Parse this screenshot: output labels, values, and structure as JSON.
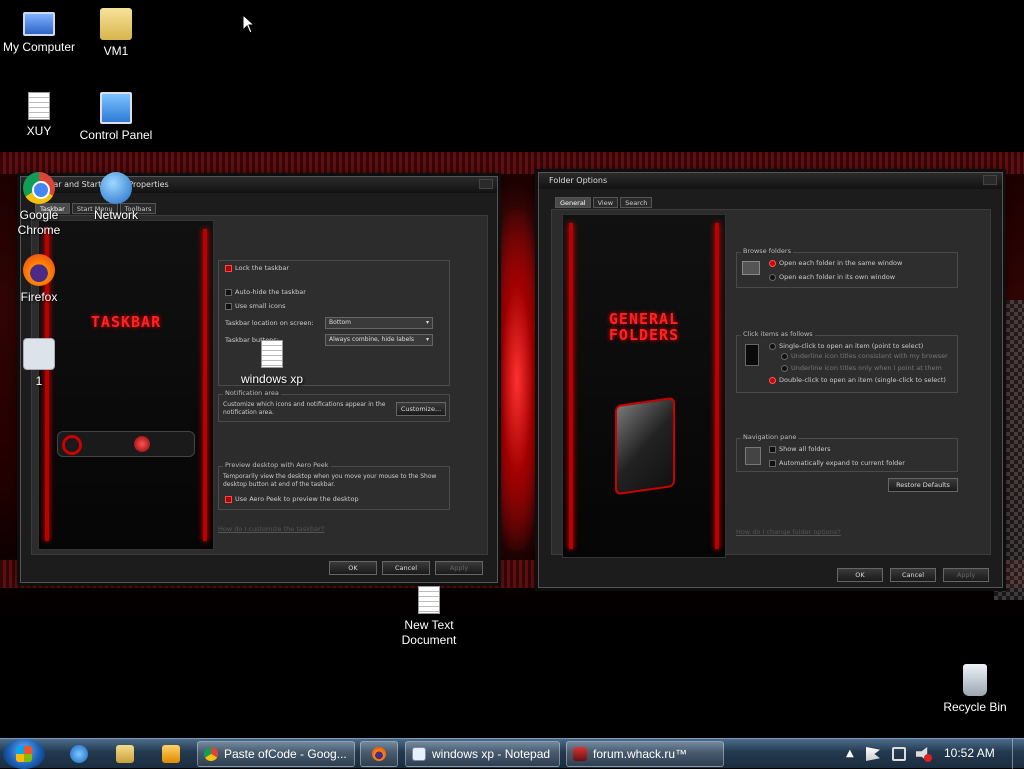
{
  "desktop": {
    "icons": [
      {
        "label": "My Computer",
        "icon": "computer-icon"
      },
      {
        "label": "VM1",
        "icon": "folder-user-icon"
      },
      {
        "label": "XUY",
        "icon": "text-document-icon"
      },
      {
        "label": "Control Panel",
        "icon": "control-panel-icon"
      },
      {
        "label": "Google\nChrome",
        "icon": "chrome-icon"
      },
      {
        "label": "Network",
        "icon": "network-icon"
      },
      {
        "label": "Firefox",
        "icon": "firefox-icon"
      },
      {
        "label": "1",
        "icon": "settings-file-icon"
      },
      {
        "label": "windows xp",
        "icon": "text-document-icon"
      },
      {
        "label": "New Text\nDocument",
        "icon": "text-document-icon"
      },
      {
        "label": "Recycle Bin",
        "icon": "recycle-bin-icon"
      }
    ]
  },
  "taskbar_props": {
    "title": "Taskbar and Start Menu Properties",
    "tabs": [
      "Taskbar",
      "Start Menu",
      "Toolbars"
    ],
    "preview_art": "TASKBAR",
    "appearance": {
      "lock": "Lock the taskbar",
      "autohide": "Auto-hide the taskbar",
      "small_icons": "Use small icons",
      "location_label": "Taskbar location on screen:",
      "location_value": "Bottom",
      "buttons_label": "Taskbar buttons:",
      "buttons_value": "Always combine, hide labels"
    },
    "notification": {
      "title": "Notification area",
      "desc": "Customize which icons and notifications appear in the notification area.",
      "customize": "Customize..."
    },
    "peek": {
      "title": "Preview desktop with Aero Peek",
      "desc": "Temporarily view the desktop when you move your mouse to the Show desktop button at end of the taskbar.",
      "option": "Use Aero Peek to preview the desktop"
    },
    "help_link": "How do I customize the taskbar?",
    "ok": "OK",
    "cancel": "Cancel",
    "apply": "Apply"
  },
  "folder_options": {
    "title": "Folder Options",
    "tabs": [
      "General",
      "View",
      "Search"
    ],
    "preview_art_1": "GENERAL",
    "preview_art_2": "FOLDERS",
    "browse": {
      "title": "Browse folders",
      "same": "Open each folder in the same window",
      "own": "Open each folder in its own window"
    },
    "click": {
      "title": "Click items as follows",
      "single": "Single-click to open an item (point to select)",
      "underline_browser": "Underline icon titles consistent with my browser",
      "underline_point": "Underline icon titles only when I point at them",
      "double": "Double-click to open an item (single-click to select)"
    },
    "nav": {
      "title": "Navigation pane",
      "show_all": "Show all folders",
      "auto_expand": "Automatically expand to current folder"
    },
    "restore": "Restore Defaults",
    "help_link": "How do I change folder options?",
    "ok": "OK",
    "cancel": "Cancel",
    "apply": "Apply"
  },
  "taskbar": {
    "tasks": [
      {
        "label": "Paste ofCode - Goog...",
        "icon": "chrome-icon"
      },
      {
        "label": "",
        "icon": "firefox-icon"
      },
      {
        "label": "windows xp - Notepad",
        "icon": "notepad-icon"
      },
      {
        "label": "forum.whack.ru™",
        "icon": "app-icon"
      }
    ],
    "clock": "10:52 AM"
  }
}
